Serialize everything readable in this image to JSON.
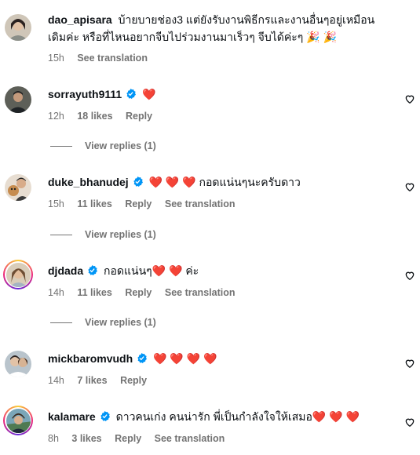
{
  "comments": [
    {
      "username": "dao_apisara",
      "verified": false,
      "text_line1": "บ้ายบายช่อง3 แต่ยังรับงานพิธีกรและงานอื่นๆอยู่เหมือน",
      "text_line2": "เดิมค่ะ หรือที่ไหนอยากจีบไปร่วมงานมาเร็วๆ จีบได้ค่ะๆ 🎉 🎉",
      "time": "15h",
      "see_translation": "See translation"
    },
    {
      "username": "sorrayuth9111",
      "verified": true,
      "text": "❤️",
      "time": "12h",
      "likes": "18 likes",
      "reply": "Reply",
      "view_replies": "View replies (1)"
    },
    {
      "username": "duke_bhanudej",
      "verified": true,
      "text": "❤️ ❤️ ❤️  กอดแน่นๆนะครับดาว",
      "time": "15h",
      "likes": "11 likes",
      "reply": "Reply",
      "see_translation": "See translation",
      "view_replies": "View replies (1)"
    },
    {
      "username": "djdada",
      "verified": true,
      "text": "กอดแน่นๆ❤️ ❤️ ค่ะ",
      "time": "14h",
      "likes": "11 likes",
      "reply": "Reply",
      "see_translation": "See translation",
      "view_replies": "View replies (1)"
    },
    {
      "username": "mickbaromvudh",
      "verified": true,
      "text": "❤️ ❤️ ❤️ ❤️",
      "time": "14h",
      "likes": "7 likes",
      "reply": "Reply"
    },
    {
      "username": "kalamare",
      "verified": true,
      "text": "ดาวคนเก่ง คนน่ารัก พี่เป็นกำลังใจให้เสมอ❤️ ❤️ ❤️",
      "time": "8h",
      "likes": "3 likes",
      "reply": "Reply",
      "see_translation": "See translation"
    }
  ],
  "colors": {
    "text": "#0c1014",
    "secondary": "#737373",
    "verified": "#0095f6",
    "heart": "#e0203a"
  },
  "icons": {
    "like": "heart-outline-icon",
    "verified": "verified-badge-icon"
  }
}
